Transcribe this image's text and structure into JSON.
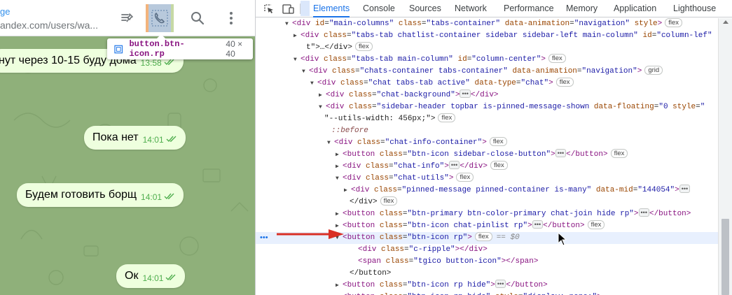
{
  "chat": {
    "header": {
      "title": "ge",
      "subtitle": "andex.com/users/wa..."
    },
    "header_icons": [
      "pinned-messages-icon",
      "phone-call-icon",
      "search-icon",
      "more-vertical-icon"
    ],
    "messages": [
      {
        "text": "нут через 10-15 буду дома",
        "time": "13:58"
      },
      {
        "text": "Пока нет",
        "time": "14:01"
      },
      {
        "text": "Будем готовить борщ",
        "time": "14:01"
      },
      {
        "text": "Ок",
        "time": "14:01"
      }
    ],
    "background_color": "#8fb07a",
    "bubble_color": "#eeffde"
  },
  "inspect_tooltip": {
    "selector": "button.btn-icon.rp",
    "size": "40 × 40"
  },
  "devtools": {
    "tabs": [
      "Elements",
      "Console",
      "Sources",
      "Network",
      "Performance",
      "Memory",
      "Application",
      "Lighthouse"
    ],
    "active_tab": "Elements",
    "accent_color": "#1a73e8",
    "rows": [
      {
        "tri": "▼",
        "tag": "div",
        "attrs": [
          [
            "id",
            "main-columns"
          ],
          [
            "class",
            "tabs-container"
          ],
          [
            "data-animation",
            "navigation"
          ],
          [
            "style",
            null
          ]
        ],
        "badge": "flex"
      },
      {
        "tri": "▶",
        "tag": "div",
        "attrs": [
          [
            "class",
            "tabs-tab chatlist-container sidebar sidebar-left main-column"
          ],
          [
            "id",
            "column-lef"
          ]
        ]
      },
      {
        "text": "t\">…</div>",
        "badge": "flex"
      },
      {
        "tri": "▼",
        "tag": "div",
        "attrs": [
          [
            "class",
            "tabs-tab main-column"
          ],
          [
            "id",
            "column-center"
          ]
        ],
        "badge": "flex"
      },
      {
        "tri": "▼",
        "tag": "div",
        "attrs": [
          [
            "class",
            "chats-container tabs-container"
          ],
          [
            "data-animation",
            "navigation"
          ]
        ],
        "badge": "grid"
      },
      {
        "tri": "▼",
        "tag": "div",
        "attrs": [
          [
            "class",
            "chat tabs-tab active"
          ],
          [
            "data-type",
            "chat"
          ]
        ],
        "badge": "flex"
      },
      {
        "tri": "▶",
        "tag": "div",
        "attrs": [
          [
            "class",
            "chat-background"
          ]
        ],
        "collapsed": true,
        "close": "div"
      },
      {
        "tri": "▼",
        "tag": "div",
        "attrs": [
          [
            "class",
            "sidebar-header topbar is-pinned-message-shown"
          ],
          [
            "data-floating",
            "0"
          ],
          [
            "style",
            ""
          ]
        ]
      },
      {
        "text": "\"--utils-width: 456px;\">",
        "badge": "flex"
      },
      {
        "pseudo": "::before"
      },
      {
        "tri": "▼",
        "tag": "div",
        "attrs": [
          [
            "class",
            "chat-info-container"
          ]
        ],
        "badge": "flex"
      },
      {
        "tri": "▶",
        "tag": "button",
        "attrs": [
          [
            "class",
            "btn-icon sidebar-close-button"
          ]
        ],
        "collapsed": true,
        "close": "button",
        "badge": "flex"
      },
      {
        "tri": "▶",
        "tag": "div",
        "attrs": [
          [
            "class",
            "chat-info"
          ]
        ],
        "collapsed": true,
        "close": "div",
        "badge": "flex"
      },
      {
        "tri": "▼",
        "tag": "div",
        "attrs": [
          [
            "class",
            "chat-utils"
          ]
        ],
        "badge": "flex"
      },
      {
        "tri": "▶",
        "tag": "div",
        "attrs": [
          [
            "class",
            "pinned-message pinned-container is-many"
          ],
          [
            "data-mid",
            "144054"
          ]
        ],
        "collapsed": true
      },
      {
        "text": "</div>",
        "badge": "flex"
      },
      {
        "tri": "▶",
        "tag": "button",
        "attrs": [
          [
            "class",
            "btn-primary btn-color-primary chat-join hide rp"
          ]
        ],
        "collapsed": true,
        "close": "button"
      },
      {
        "tri": "▶",
        "tag": "button",
        "attrs": [
          [
            "class",
            "btn-icon chat-pinlist rp"
          ]
        ],
        "collapsed": true,
        "close": "button",
        "badge": "flex"
      },
      {
        "tri": "▼",
        "tag": "button",
        "attrs": [
          [
            "class",
            "btn-icon rp"
          ]
        ],
        "badge": "flex",
        "selected": true,
        "eq": "== $0"
      },
      {
        "tag": "div",
        "attrs": [
          [
            "class",
            "c-ripple"
          ]
        ],
        "close": "div"
      },
      {
        "tag": "span",
        "attrs": [
          [
            "class",
            "tgico button-icon"
          ]
        ],
        "inner": "",
        "close": "span"
      },
      {
        "text": "</button>"
      },
      {
        "tri": "▶",
        "tag": "button",
        "attrs": [
          [
            "class",
            "btn-icon rp hide"
          ]
        ],
        "collapsed": true,
        "close": "button"
      },
      {
        "tri": "▶",
        "tag": "button",
        "attrs": [
          [
            "class",
            "btn-icon rp hide"
          ],
          [
            "style",
            "display: none;"
          ]
        ]
      }
    ]
  }
}
